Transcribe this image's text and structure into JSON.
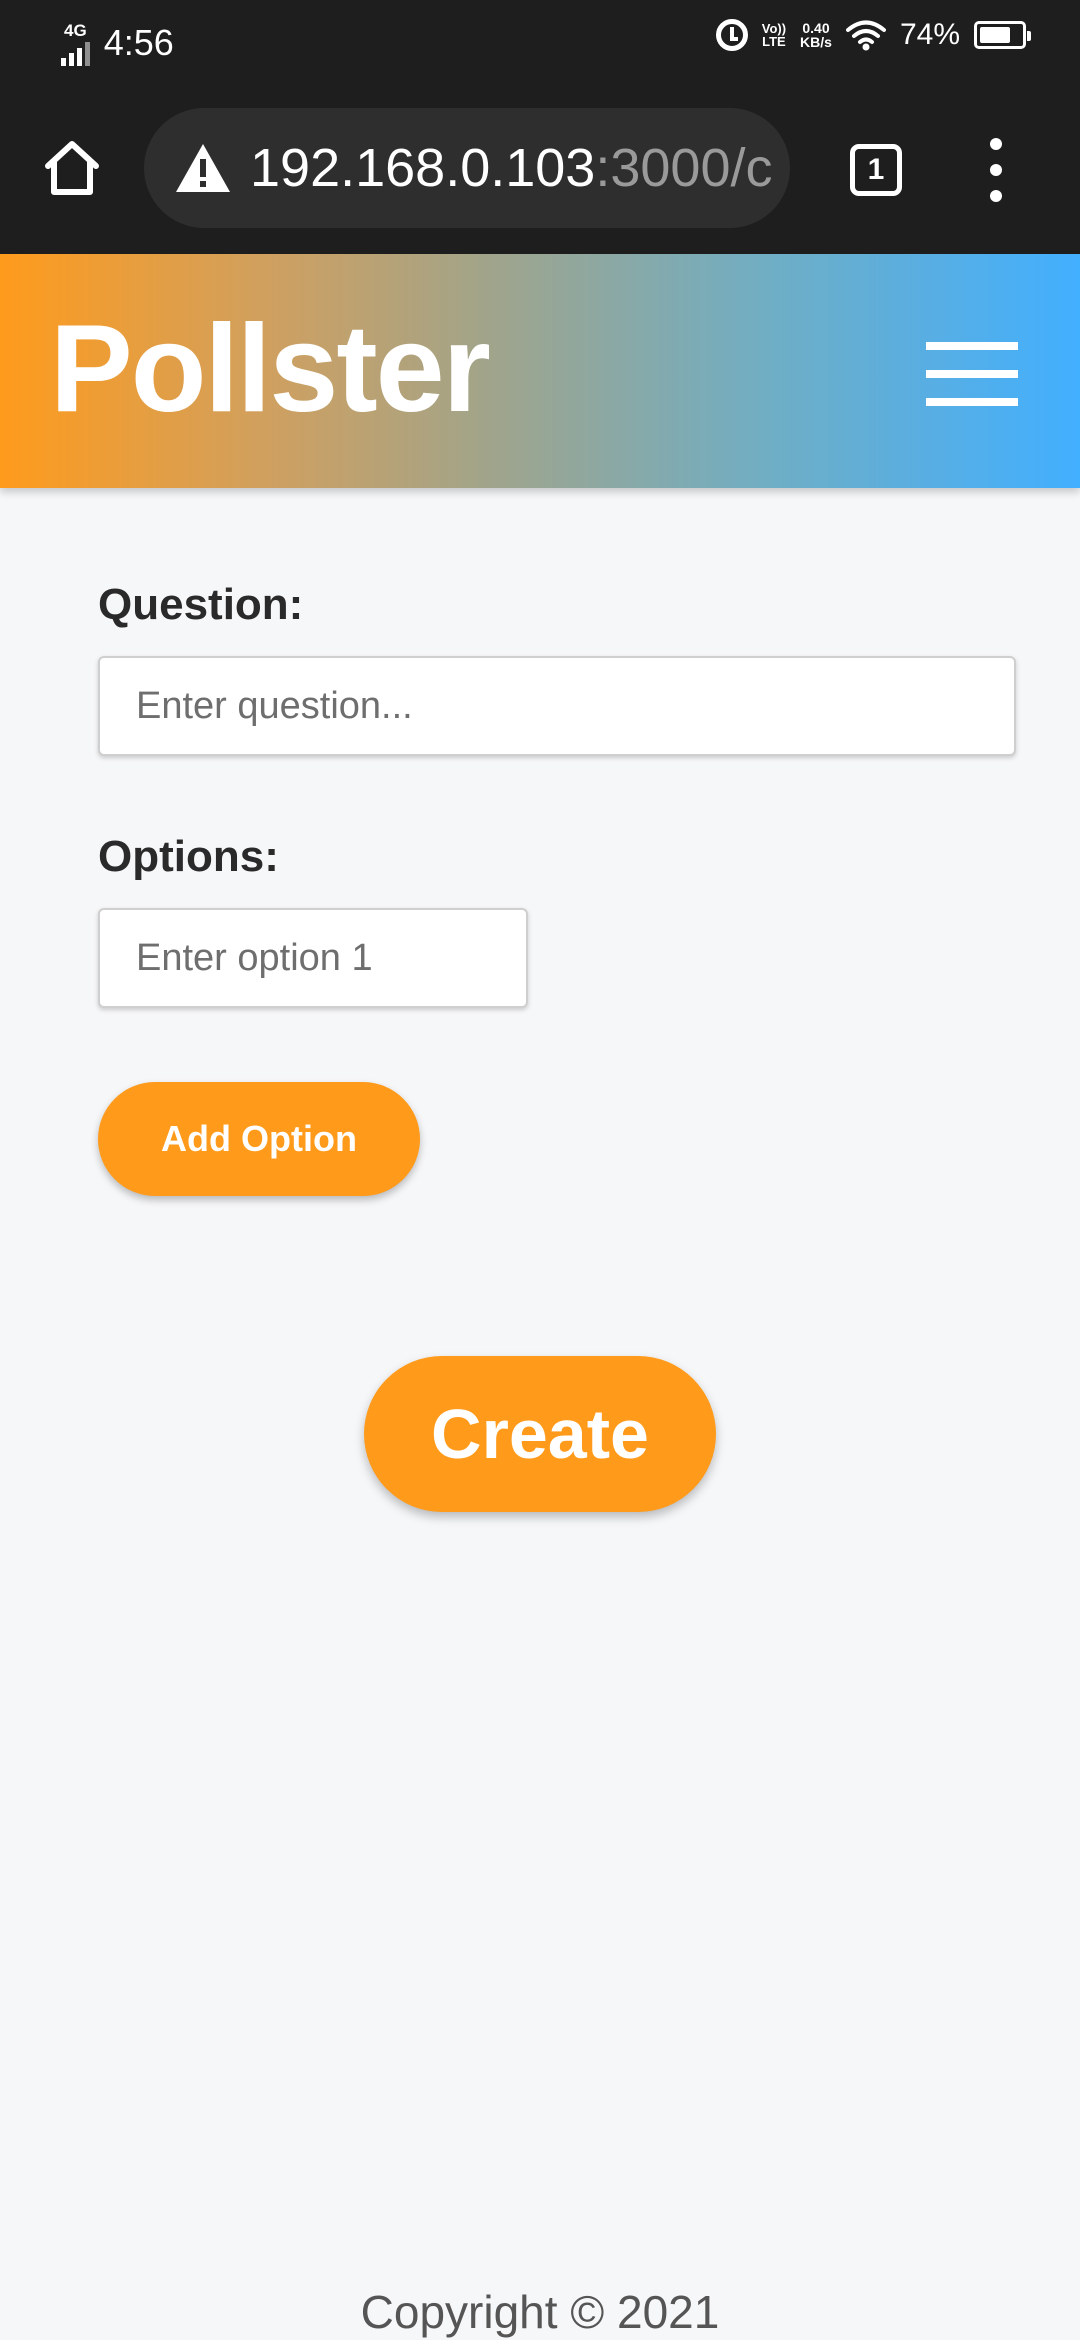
{
  "status_bar": {
    "network": "4G",
    "time": "4:56",
    "volte_line1": "Vo))",
    "volte_line2": "LTE",
    "speed_value": "0.40",
    "speed_unit": "KB/s",
    "battery": "74%",
    "battery_level": 0.74
  },
  "browser": {
    "url_host": "192.168.0.103",
    "url_rest": ":3000/c",
    "tab_count": "1"
  },
  "header": {
    "brand": "Pollster"
  },
  "form": {
    "question_label": "Question:",
    "question_placeholder": "Enter question...",
    "question_value": "",
    "options_label": "Options:",
    "option1_placeholder": "Enter option 1",
    "option1_value": "",
    "add_option_label": "Add Option",
    "create_label": "Create"
  },
  "footer": {
    "copyright": "Copyright © 2021"
  },
  "colors": {
    "accent": "#ff9a1a",
    "header_gradient_start": "#ff9b1c",
    "header_gradient_end": "#42afff"
  }
}
